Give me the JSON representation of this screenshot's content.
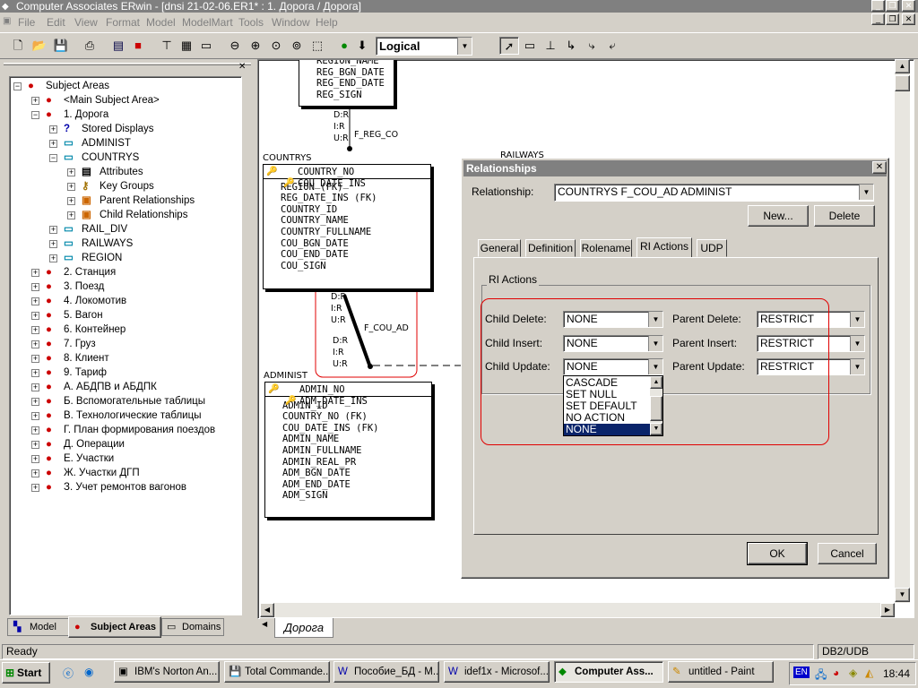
{
  "window": {
    "title": "Computer Associates ERwin - [dnsi 21-02-06.ER1* : 1. Дорога / Дорога]"
  },
  "menu": [
    "File",
    "Edit",
    "View",
    "Format",
    "Model",
    "ModelMart",
    "Tools",
    "Window",
    "Help"
  ],
  "toolbar": {
    "view_mode": "Logical"
  },
  "tree": {
    "root": "Subject Areas",
    "items": [
      {
        "label": "<Main Subject Area>"
      },
      {
        "label": "1. Дорога"
      },
      {
        "label": "Stored Displays"
      },
      {
        "label": "ADMINIST"
      },
      {
        "label": "COUNTRYS"
      },
      {
        "label": "Attributes"
      },
      {
        "label": "Key Groups"
      },
      {
        "label": "Parent Relationships"
      },
      {
        "label": "Child Relationships"
      },
      {
        "label": "RAIL_DIV"
      },
      {
        "label": "RAILWAYS"
      },
      {
        "label": "REGION"
      },
      {
        "label": "2. Станция"
      },
      {
        "label": "3. Поезд"
      },
      {
        "label": "4. Локомотив"
      },
      {
        "label": "5. Вагон"
      },
      {
        "label": "6. Контейнер"
      },
      {
        "label": "7. Груз"
      },
      {
        "label": "8. Клиент"
      },
      {
        "label": "9. Тариф"
      },
      {
        "label": "А. АБДПВ и АБДПК"
      },
      {
        "label": "Б. Вспомогательные таблицы"
      },
      {
        "label": "В. Технологические таблицы"
      },
      {
        "label": "Г. План формирования поездов"
      },
      {
        "label": "Д. Операции"
      },
      {
        "label": "Е. Участки"
      },
      {
        "label": "Ж. Участки ДГП"
      },
      {
        "label": "З. Учет ремонтов вагонов"
      }
    ]
  },
  "bottom_tabs": [
    "Model",
    "Subject Areas",
    "Domains"
  ],
  "diagram": {
    "region_attrs": [
      "REGION_NAME",
      "REG_BGN_DATE",
      "REG_END_DATE",
      "REG_SIGN"
    ],
    "rel1": {
      "d": "D:R",
      "i": "I:R",
      "u": "U:R",
      "name": "F_REG_CO"
    },
    "countrys": {
      "name": "COUNTRYS",
      "keys": [
        "COUNTRY_NO",
        "COU_DATE_INS"
      ],
      "attrs": [
        "REGION (FK)",
        "REG_DATE_INS (FK)",
        "COUNTRY_ID",
        "COUNTRY_NAME",
        "COUNTRY_FULLNAME",
        "COU_BGN_DATE",
        "COU_END_DATE",
        "COU_SIGN"
      ]
    },
    "rel2": {
      "d1": "D:R",
      "i1": "I:R",
      "u1": "U:R",
      "name": "F_COU_AD",
      "d2": "D:R",
      "i2": "I:R",
      "u2": "U:R"
    },
    "administ": {
      "name": "ADMINIST",
      "keys": [
        "ADMIN_NO",
        "ADM_DATE_INS"
      ],
      "attrs": [
        "ADMIN_ID",
        "COUNTRY_NO (FK)",
        "COU_DATE_INS (FK)",
        "ADMIN_NAME",
        "ADMIN_FULLNAME",
        "ADMIN_REAL_PR",
        "ADM_BGN_DATE",
        "ADM_END_DATE",
        "ADM_SIGN"
      ]
    },
    "railways_hint": "RAILWAYS",
    "page_tab": "Дорога"
  },
  "dialog": {
    "title": "Relationships",
    "relationship_label": "Relationship:",
    "relationship_value": "COUNTRYS F_COU_AD ADMINIST",
    "new_button": "New...",
    "delete_button": "Delete",
    "tabs": [
      "General",
      "Definition",
      "Rolename",
      "RI Actions",
      "UDP"
    ],
    "group_title": "RI Actions",
    "child_delete_label": "Child Delete:",
    "child_delete": "NONE",
    "child_insert_label": "Child Insert:",
    "child_insert": "NONE",
    "child_update_label": "Child Update:",
    "child_update": "NONE",
    "parent_delete_label": "Parent Delete:",
    "parent_delete": "RESTRICT",
    "parent_insert_label": "Parent Insert:",
    "parent_insert": "RESTRICT",
    "parent_update_label": "Parent Update:",
    "parent_update": "RESTRICT",
    "dropdown_options": [
      "CASCADE",
      "SET NULL",
      "SET DEFAULT",
      "NO ACTION",
      "NONE"
    ],
    "ok_button": "OK",
    "cancel_button": "Cancel"
  },
  "status": {
    "text": "Ready",
    "db": "DB2/UDB"
  },
  "taskbar": {
    "start": "Start",
    "items": [
      "IBM's Norton An...",
      "Total Commande...",
      "Пособие_БД - M...",
      "idef1x - Microsof...",
      "Computer Ass...",
      "untitled - Paint"
    ],
    "lang": "EN",
    "clock": "18:44"
  }
}
